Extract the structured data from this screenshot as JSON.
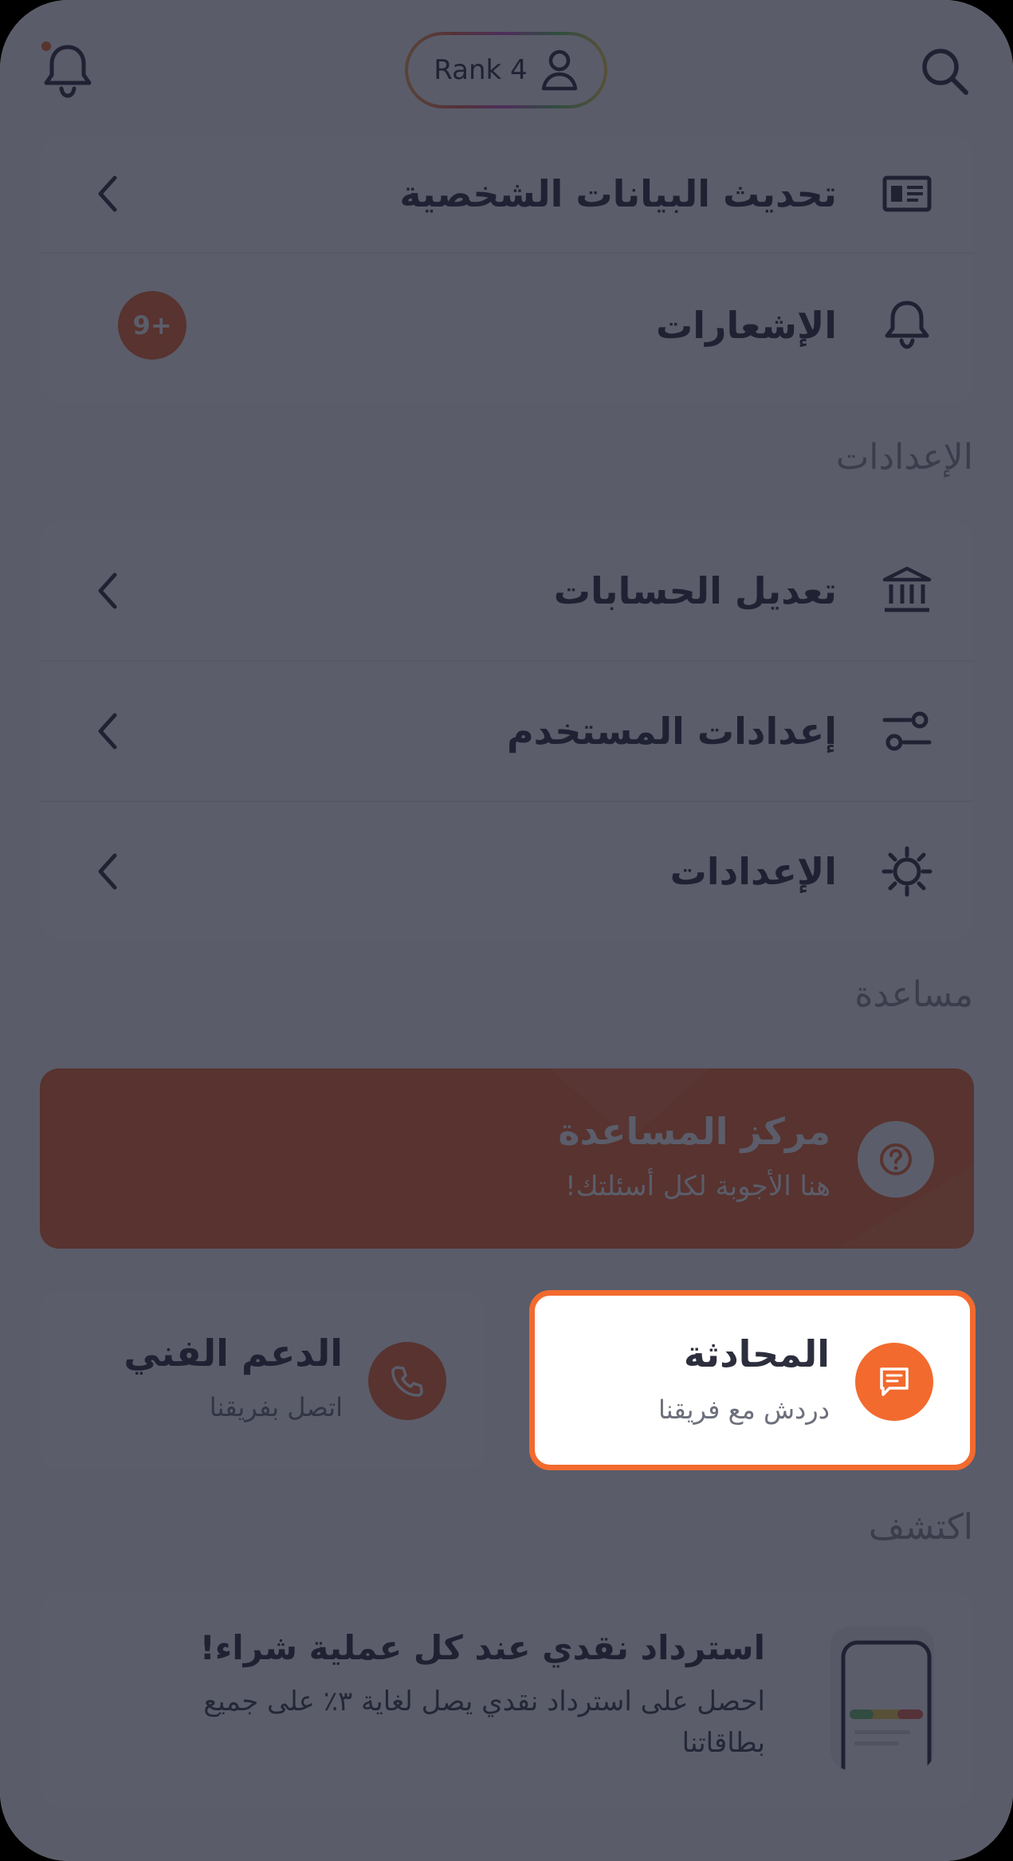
{
  "header": {
    "rank_label": "Rank 4",
    "icons": {
      "search": "search-icon",
      "profile": "person-icon",
      "notifications": "bell-icon"
    }
  },
  "profile_card": {
    "items": [
      {
        "label": "تحديث البيانات الشخصية",
        "icon": "id-card-icon"
      },
      {
        "label": "الإشعارات",
        "icon": "bell-icon",
        "badge": "9+"
      }
    ]
  },
  "settings_section": {
    "title": "الإعدادات",
    "items": [
      {
        "label": "تعديل الحسابات",
        "icon": "bank-icon"
      },
      {
        "label": "إعدادات المستخدم",
        "icon": "sliders-icon"
      },
      {
        "label": "الإعدادات",
        "icon": "gear-icon"
      }
    ]
  },
  "help_section": {
    "title": "مساعدة",
    "help_center": {
      "title": "مركز المساعدة",
      "subtitle": "هنا الأجوبة لكل أسئلتك!",
      "icon": "question-icon"
    },
    "chat": {
      "title": "المحادثة",
      "subtitle": "دردش مع فريقنا",
      "icon": "chat-icon"
    },
    "support": {
      "title": "الدعم الفني",
      "subtitle": "اتصل بفريقنا",
      "icon": "phone-icon"
    }
  },
  "discover_section": {
    "title": "اكتشف",
    "promo": {
      "title": "استرداد نقدي عند كل عملية شراء!",
      "description": "احصل على استرداد نقدي يصل لغاية ٣٪ على جميع بطاقاتنا",
      "icon": "phone-illustration-icon"
    }
  },
  "colors": {
    "accent": "#f26a2e",
    "text_dark": "#2c2e3d",
    "overlay": "#1c1e30"
  }
}
